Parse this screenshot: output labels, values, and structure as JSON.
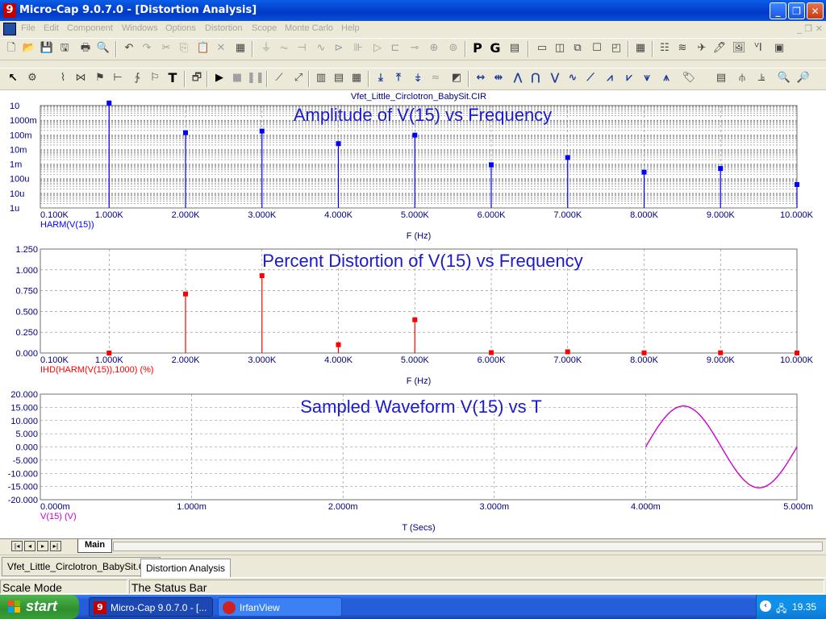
{
  "window": {
    "title": "Micro-Cap 9.0.7.0 - [Distortion Analysis]",
    "icon_glyph": "9",
    "min_glyph": "_",
    "max_glyph": "❐",
    "close_glyph": "✕"
  },
  "menu": [
    "File",
    "Edit",
    "Component",
    "Windows",
    "Options",
    "Distortion",
    "Scope",
    "Monte Carlo",
    "Help"
  ],
  "mdi_controls": "_ ❐ ✕",
  "toolbar1": {
    "p_label": "P",
    "g_label": "G"
  },
  "toolbar2": {
    "text_tool": "T"
  },
  "plot": {
    "file_title": "Vfet_Little_Circlotron_BabySit.CIR",
    "colors": {
      "amp": "#0000ff",
      "dist": "#ff0000",
      "wave": "#cc00cc",
      "grid": "#808080",
      "axis_text": "#000080"
    },
    "panel1": {
      "title": "Amplitude of V(15) vs Frequency",
      "y_ticks": [
        "10",
        "1000m",
        "100m",
        "10m",
        "1m",
        "100u",
        "10u",
        "1u"
      ],
      "x_ticks": [
        "0.100K",
        "1.000K",
        "2.000K",
        "3.000K",
        "4.000K",
        "5.000K",
        "6.000K",
        "7.000K",
        "8.000K",
        "9.000K",
        "10.000K"
      ],
      "trace_label": "HARM(V(15))",
      "x_label": "F (Hz)"
    },
    "panel2": {
      "title": "Percent Distortion of V(15) vs Frequency",
      "y_ticks": [
        "1.250",
        "1.000",
        "0.750",
        "0.500",
        "0.250",
        "0.000"
      ],
      "x_ticks": [
        "0.100K",
        "1.000K",
        "2.000K",
        "3.000K",
        "4.000K",
        "5.000K",
        "6.000K",
        "7.000K",
        "8.000K",
        "9.000K",
        "10.000K"
      ],
      "trace_label": "IHD(HARM(V(15)),1000) (%)",
      "x_label": "F (Hz)"
    },
    "panel3": {
      "title": "Sampled Waveform  V(15) vs T",
      "y_ticks": [
        "20.000",
        "15.000",
        "10.000",
        "5.000",
        "0.000",
        "-5.000",
        "-10.000",
        "-15.000",
        "-20.000"
      ],
      "x_ticks": [
        "0.000m",
        "1.000m",
        "2.000m",
        "3.000m",
        "4.000m",
        "5.000m"
      ],
      "trace_label": "V(15) (V)",
      "x_label": "T (Secs)"
    }
  },
  "chart_data": [
    {
      "type": "bar",
      "title": "Amplitude of V(15) vs Frequency",
      "xlabel": "F (Hz)",
      "ylabel": "HARM(V(15))",
      "y_scale": "log",
      "xlim": [
        100,
        10000
      ],
      "ylim": [
        1e-06,
        10
      ],
      "x": [
        1000,
        2000,
        3000,
        4000,
        5000,
        6000,
        7000,
        8000,
        9000,
        10000
      ],
      "values": [
        15,
        0.14,
        0.18,
        0.025,
        0.095,
        0.0009,
        0.0028,
        0.00028,
        0.0005,
        4e-05
      ],
      "grid": true
    },
    {
      "type": "bar",
      "title": "Percent Distortion of V(15) vs Frequency",
      "xlabel": "F (Hz)",
      "ylabel": "IHD(HARM(V(15)),1000) (%)",
      "xlim": [
        100,
        10000
      ],
      "ylim": [
        0,
        1.25
      ],
      "x": [
        1000,
        2000,
        3000,
        4000,
        5000,
        6000,
        7000,
        8000,
        9000,
        10000
      ],
      "values": [
        0,
        0.71,
        0.93,
        0.1,
        0.4,
        0.005,
        0.015,
        0.002,
        0.003,
        0.0002
      ],
      "grid": true
    },
    {
      "type": "line",
      "title": "Sampled Waveform  V(15) vs T",
      "xlabel": "T (Secs)",
      "ylabel": "V(15) (V)",
      "xlim": [
        0,
        0.005
      ],
      "ylim": [
        -20,
        20
      ],
      "x": [
        0.004,
        0.0041,
        0.0042,
        0.0043,
        0.0044,
        0.0045,
        0.0046,
        0.0047,
        0.0048,
        0.0049,
        0.005
      ],
      "values": [
        0,
        9.2,
        14.8,
        14.8,
        9.2,
        0,
        -9.2,
        -14.8,
        -14.8,
        -9.2,
        0
      ],
      "grid": true
    }
  ],
  "tabs": {
    "sheet": "Main"
  },
  "doc_tabs": [
    "Vfet_Little_Circlotron_BabySit.CIR",
    "Distortion Analysis"
  ],
  "status": {
    "mode": "Scale Mode",
    "text": "The Status Bar"
  },
  "taskbar": {
    "start": "start",
    "items": [
      "Micro-Cap 9.0.7.0 - [...",
      "IrfanView"
    ],
    "clock": "19.35"
  }
}
